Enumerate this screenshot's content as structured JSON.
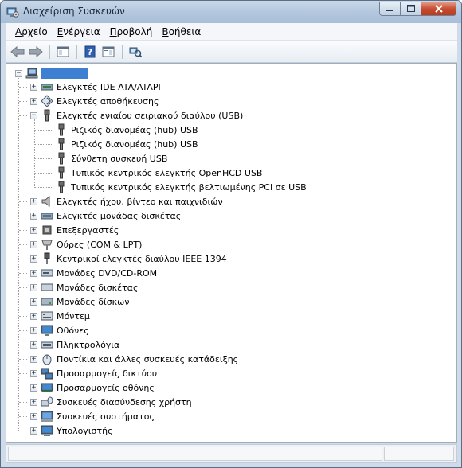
{
  "window": {
    "title": "Διαχείριση Συσκευών"
  },
  "menu": [
    "Αρχείο",
    "Ενέργεια",
    "Προβολή",
    "Βοήθεια"
  ],
  "toolbar": {
    "buttons": [
      "back-icon",
      "forward-icon",
      "show-hide-tree-icon",
      "help-icon",
      "properties-icon",
      "scan-hardware-icon"
    ]
  },
  "tree": {
    "root": {
      "label": "",
      "icon": "computer-icon",
      "expanded": true
    },
    "categories": [
      {
        "label": "Ελεγκτές IDE ATA/ATAPI",
        "icon": "ide-controller-icon",
        "expanded": false,
        "children": []
      },
      {
        "label": "Ελεγκτές αποθήκευσης",
        "icon": "storage-controller-icon",
        "expanded": false,
        "children": []
      },
      {
        "label": "Ελεγκτές ενιαίου σειριακού διαύλου (USB)",
        "icon": "usb-icon",
        "expanded": true,
        "children": [
          {
            "label": "Ριζικός διανομέας (hub) USB",
            "icon": "usb-icon"
          },
          {
            "label": "Ριζικός διανομέας (hub) USB",
            "icon": "usb-icon"
          },
          {
            "label": "Σύνθετη συσκευή USB",
            "icon": "usb-icon"
          },
          {
            "label": "Τυπικός κεντρικός ελεγκτής OpenHCD USB",
            "icon": "usb-icon"
          },
          {
            "label": "Τυπικός κεντρικός ελεγκτής βελτιωμένης PCI σε USB",
            "icon": "usb-icon"
          }
        ]
      },
      {
        "label": "Ελεγκτές ήχου, βίντεο και παιχνιδιών",
        "icon": "speaker-icon",
        "expanded": false,
        "children": []
      },
      {
        "label": "Ελεγκτές μονάδας δισκέτας",
        "icon": "floppy-controller-icon",
        "expanded": false,
        "children": []
      },
      {
        "label": "Επεξεργαστές",
        "icon": "processor-icon",
        "expanded": false,
        "children": []
      },
      {
        "label": "Θύρες (COM & LPT)",
        "icon": "port-icon",
        "expanded": false,
        "children": []
      },
      {
        "label": "Κεντρικοί ελεγκτές διαύλου IEEE 1394",
        "icon": "ieee1394-icon",
        "expanded": false,
        "children": []
      },
      {
        "label": "Μονάδες DVD/CD-ROM",
        "icon": "dvd-drive-icon",
        "expanded": false,
        "children": []
      },
      {
        "label": "Μονάδες δισκέτας",
        "icon": "floppy-drive-icon",
        "expanded": false,
        "children": []
      },
      {
        "label": "Μονάδες δίσκων",
        "icon": "disk-drive-icon",
        "expanded": false,
        "children": []
      },
      {
        "label": "Μόντεμ",
        "icon": "modem-icon",
        "expanded": false,
        "children": []
      },
      {
        "label": "Οθόνες",
        "icon": "monitor-icon",
        "expanded": false,
        "children": []
      },
      {
        "label": "Πληκτρολόγια",
        "icon": "keyboard-icon",
        "expanded": false,
        "children": []
      },
      {
        "label": "Ποντίκια και άλλες συσκευές κατάδειξης",
        "icon": "mouse-icon",
        "expanded": false,
        "children": []
      },
      {
        "label": "Προσαρμογείς δικτύου",
        "icon": "network-adapter-icon",
        "expanded": false,
        "children": []
      },
      {
        "label": "Προσαρμογείς οθόνης",
        "icon": "display-adapter-icon",
        "expanded": false,
        "children": []
      },
      {
        "label": "Συσκευές διασύνδεσης χρήστη",
        "icon": "hid-icon",
        "expanded": false,
        "children": []
      },
      {
        "label": "Συσκευές συστήματος",
        "icon": "system-device-icon",
        "expanded": false,
        "children": []
      },
      {
        "label": "Υπολογιστής",
        "icon": "computer-icon",
        "expanded": false,
        "children": []
      }
    ]
  },
  "colors": {
    "selection": "#3d7fd0",
    "titlebar": "#b3c7de",
    "close_button": "#c44b2f"
  }
}
